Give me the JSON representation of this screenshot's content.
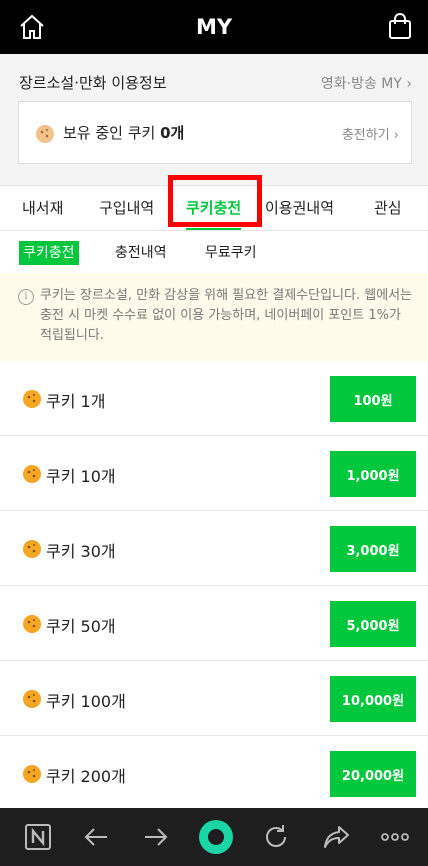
{
  "header": {
    "title": "MY",
    "home_icon": "home-icon",
    "bag_icon": "shopping-bag-icon"
  },
  "info": {
    "label": "장르소설·만화 이용정보",
    "link": "영화·방송 MY",
    "owned_prefix": "보유 중인 쿠키",
    "owned_count": "0개",
    "charge": "충전하기"
  },
  "tabs": [
    "내서재",
    "구입내역",
    "쿠키충전",
    "이용권내역",
    "관심"
  ],
  "subtabs": [
    "쿠키충전",
    "충전내역",
    "무료쿠키"
  ],
  "notice": "쿠키는 장르소설, 만화 감상을 위해 필요한 결제수단입니다. 웹에서는 충전 시 마켓 수수료 없이 이용 가능하며, 네이버페이 포인트 1%가 적립됩니다.",
  "items": [
    {
      "name": "쿠키 1개",
      "price": "100원"
    },
    {
      "name": "쿠키 10개",
      "price": "1,000원"
    },
    {
      "name": "쿠키 30개",
      "price": "3,000원"
    },
    {
      "name": "쿠키 50개",
      "price": "5,000원"
    },
    {
      "name": "쿠키 100개",
      "price": "10,000원"
    },
    {
      "name": "쿠키 200개",
      "price": "20,000원"
    }
  ],
  "colors": {
    "accent": "#00c73c",
    "highlight": "#ff0000",
    "cookie": "#f5a623"
  }
}
